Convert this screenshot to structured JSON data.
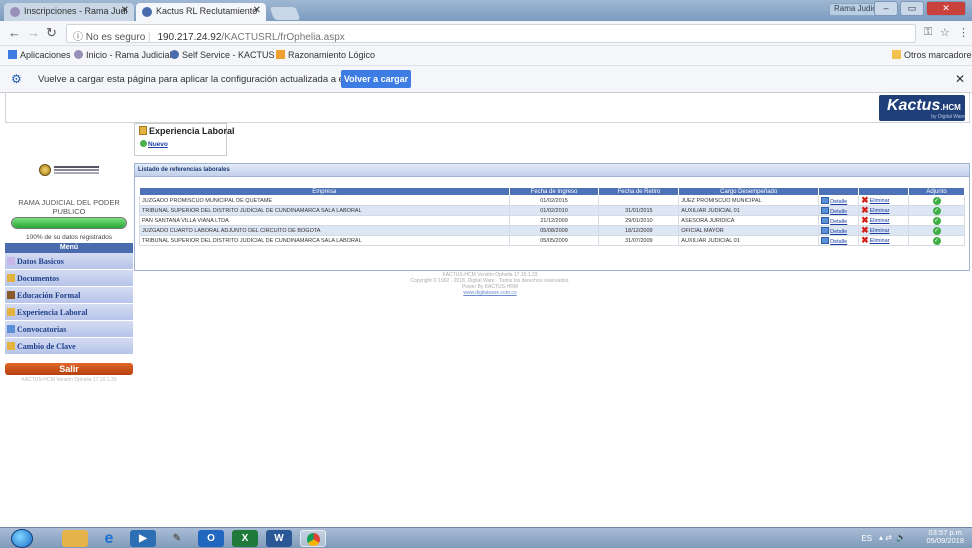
{
  "browser": {
    "tabs": [
      {
        "title": "Inscripciones - Rama Judi",
        "active": false
      },
      {
        "title": "Kactus RL Reclutamiento",
        "active": true
      }
    ],
    "window_user": "Rama Judicial",
    "address": {
      "security": "No es seguro",
      "host": "190.217.24.92",
      "path": "/KACTUSRL/frOphelia.aspx"
    },
    "bookmarks": [
      {
        "label": "Aplicaciones"
      },
      {
        "label": "Inicio - Rama Judicial"
      },
      {
        "label": "Self Service - KACTUS"
      },
      {
        "label": "Razonamiento Lógico"
      }
    ],
    "other_bookmarks": "Otros marcadores",
    "infobar": {
      "message": "Vuelve a cargar esta página para aplicar la configuración actualizada a este sitio web",
      "reload_label": "Volver a cargar"
    }
  },
  "header": {
    "logo": "Kactus",
    "logo_suffix": "HCM",
    "logo_sub": "by Digital Ware"
  },
  "sidebar": {
    "org_name": "RAMA JUDICIAL DEL PODER PUBLICO",
    "progress_percent": 100,
    "progress_text": "100% de su datos registrados",
    "menu_title": "Menú",
    "items": [
      {
        "label": "Datos Basicos",
        "icon_color": "#c9b6e8"
      },
      {
        "label": "Documentos",
        "icon_color": "#e3b240"
      },
      {
        "label": "Educación Formal",
        "icon_color": "#8a5a2b"
      },
      {
        "label": "Experiencia Laboral",
        "icon_color": "#e3b240"
      },
      {
        "label": "Convocatorias",
        "icon_color": "#5b8fd6"
      },
      {
        "label": "Cambio de Clave",
        "icon_color": "#e3b240"
      }
    ],
    "logout_label": "Salir",
    "version": "KACTUS-HCM Versión Ophelia 17.10.1.33"
  },
  "main": {
    "section_title": "Experiencia Laboral",
    "new_label": "Nuevo",
    "panel_title": "Listado de referencias laborales",
    "columns": [
      "Empresa",
      "Fecha de Ingreso",
      "Fecha de Retiro",
      "Cargo Desempeñado",
      "",
      "",
      "Adjunto"
    ],
    "detail_label": "Detalle",
    "delete_label": "Eliminar",
    "rows": [
      {
        "empresa": "JUZGADO PROMISCUO MUNICIPAL DE QUETAME",
        "ingreso": "01/02/2015",
        "retiro": "",
        "cargo": "JUEZ PROMISCUO MUNICIPAL"
      },
      {
        "empresa": "TRIBUNAL SUPERIOR DEL DISTRITO JUDICIAL DE CUNDINAMARCA SALA LABORAL",
        "ingreso": "01/02/2010",
        "retiro": "31/01/2015",
        "cargo": "AUXILIAR JUDICIAL 01"
      },
      {
        "empresa": "PAN SANTANA VILLA VIANA LTDA",
        "ingreso": "21/12/2009",
        "retiro": "29/01/2010",
        "cargo": "ASESORA JURIDICA"
      },
      {
        "empresa": "JUZGADO CUARTO LABORAL ADJUNTO DEL CIRCUITO DE BOGOTA",
        "ingreso": "05/08/2009",
        "retiro": "18/12/2009",
        "cargo": "OFICIAL MAYOR"
      },
      {
        "empresa": "TRIBUNAL SUPERIOR DEL DISTRITO JUDICIAL DE CUNDINAMARCA SALA LABORAL",
        "ingreso": "05/05/2009",
        "retiro": "31/07/2009",
        "cargo": "AUXILIAR JUDICIAL 01"
      }
    ],
    "footer": {
      "line1": "KACTUS-HCM Versión Ophelia 17.10.1.33",
      "line2": "Copyright © 1992 - 2018, Digital Ware · Todos los derechos reservados.",
      "line3": "Power By KACTUS-HRM",
      "link": "www.digitalware.com.co"
    }
  },
  "taskbar": {
    "language": "ES",
    "time": "03:57 p.m.",
    "date": "05/09/2018"
  }
}
